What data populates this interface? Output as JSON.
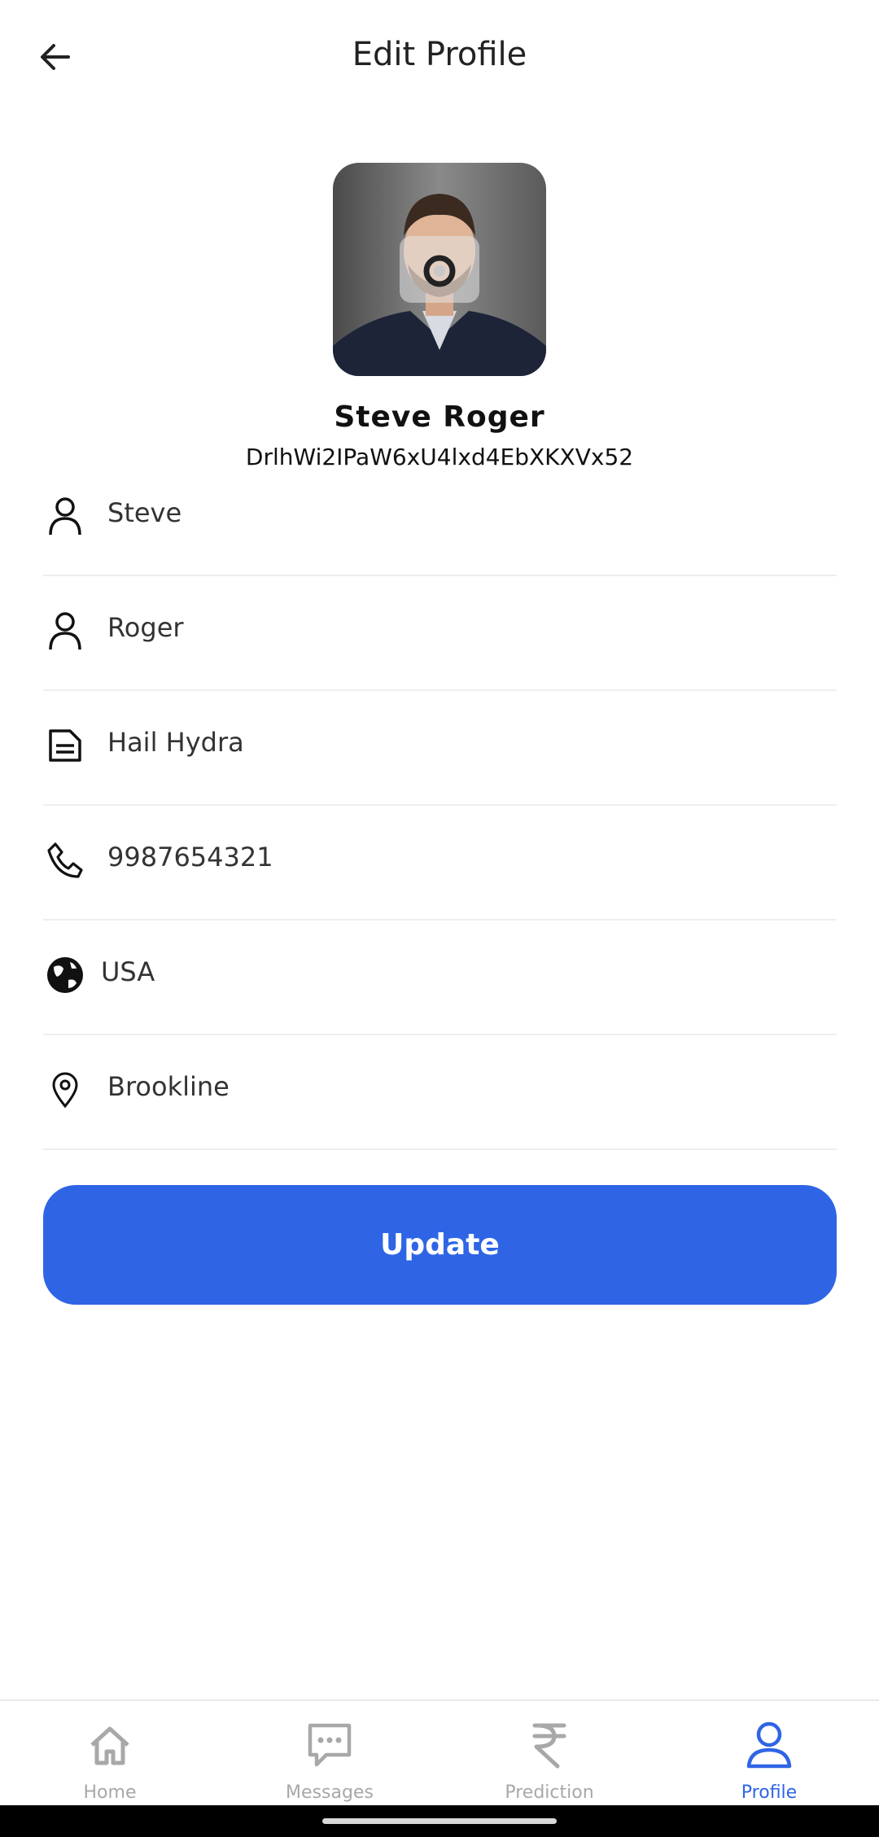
{
  "header": {
    "title": "Edit Profile"
  },
  "profile": {
    "full_name": "Steve Roger",
    "user_id": "DrlhWi2IPaW6xU4lxd4EbXKXVx52"
  },
  "fields": [
    {
      "icon": "person-icon",
      "value": "Steve"
    },
    {
      "icon": "person-icon",
      "value": "Roger"
    },
    {
      "icon": "document-icon",
      "value": "Hail Hydra"
    },
    {
      "icon": "phone-icon",
      "value": "9987654321"
    },
    {
      "icon": "globe-icon",
      "value": "USA"
    },
    {
      "icon": "location-pin-icon",
      "value": "Brookline"
    }
  ],
  "actions": {
    "update_label": "Update"
  },
  "bottom_nav": {
    "items": [
      {
        "label": "Home",
        "icon": "home-icon",
        "active": false
      },
      {
        "label": "Messages",
        "icon": "chat-icon",
        "active": false
      },
      {
        "label": "Prediction",
        "icon": "rupee-icon",
        "active": false
      },
      {
        "label": "Profile",
        "icon": "profile-icon",
        "active": true
      }
    ]
  },
  "colors": {
    "accent": "#2f65e5",
    "inactive": "#a8a8a8",
    "divider": "#eeeeee"
  }
}
